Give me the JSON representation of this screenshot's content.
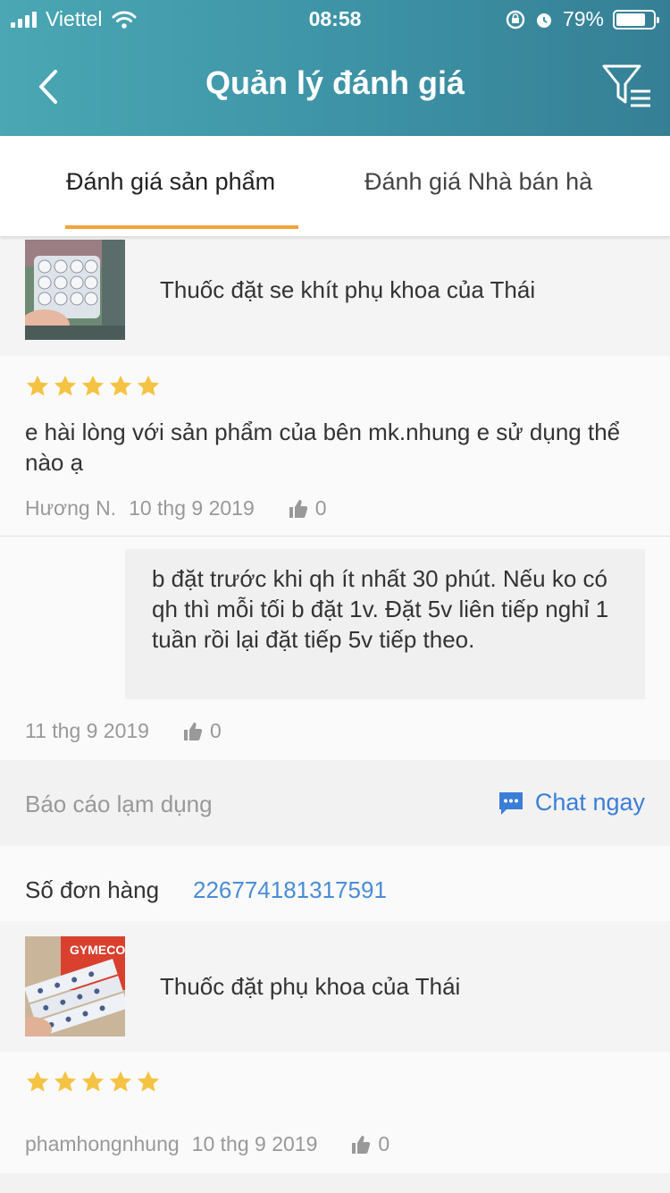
{
  "status_bar": {
    "carrier": "Viettel",
    "time": "08:58",
    "battery": "79%"
  },
  "header": {
    "title": "Quản lý đánh giá"
  },
  "tabs": [
    {
      "label": "Đánh giá sản phẩm",
      "active": true
    },
    {
      "label": "Đánh giá Nhà bán hà",
      "active": false
    }
  ],
  "colors": {
    "header_start": "#4aa7b3",
    "header_end": "#357f95",
    "tab_indicator": "#f2a33a",
    "star": "#f5c344",
    "link": "#3a7ed8"
  },
  "reviews": [
    {
      "product_name": "Thuốc đặt se khít phụ khoa của Thái",
      "rating": 5,
      "text": "e hài lòng với sản phẩm của bên mk.nhung e sử dụng thể nào ạ",
      "author": "Hương N.",
      "date": "10 thg 9 2019",
      "likes": "0",
      "reply": {
        "text": "b đặt trước khi qh ít nhất 30 phút. Nếu ko có qh thì mỗi tối b đặt 1v. Đặt 5v liên tiếp nghỉ 1 tuần rồi lại đặt tiếp 5v tiếp theo.",
        "date": "11 thg 9 2019",
        "likes": "0"
      },
      "report_label": "Báo cáo lạm dụng",
      "chat_label": "Chat ngay"
    },
    {
      "order_label": "Số đơn hàng",
      "order_number": "226774181317591",
      "product_name": "Thuốc đặt phụ khoa của Thái",
      "rating": 5,
      "author": "phamhongnhung",
      "date": "10 thg 9 2019",
      "likes": "0"
    }
  ]
}
